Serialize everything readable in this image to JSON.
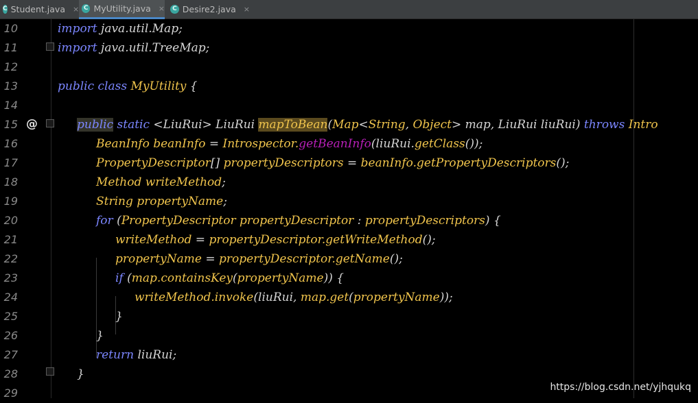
{
  "tabs": [
    {
      "icon": "C",
      "label": "Student.java",
      "active": false
    },
    {
      "icon": "C",
      "label": "MyUtility.java",
      "active": true
    },
    {
      "icon": "C",
      "label": "Desire2.java",
      "active": false
    }
  ],
  "tab_close_glyph": "×",
  "gutter": {
    "line_numbers": [
      "10",
      "11",
      "12",
      "13",
      "14",
      "15",
      "16",
      "17",
      "18",
      "19",
      "20",
      "21",
      "22",
      "23",
      "24",
      "25",
      "26",
      "27",
      "28",
      "29"
    ],
    "override_marker": "@"
  },
  "code_lines": [
    [
      [
        "kw",
        "import "
      ],
      [
        "pl",
        "java.util.Map;"
      ]
    ],
    [
      [
        "kw",
        "import "
      ],
      [
        "pl",
        "java.util.TreeMap;"
      ]
    ],
    [],
    [
      [
        "kw",
        "public class "
      ],
      [
        "fn",
        "MyUtility "
      ],
      [
        "pl",
        "{"
      ]
    ],
    [],
    [
      [
        "kw",
        "public"
      ],
      [
        "kw",
        " static "
      ],
      [
        "pl",
        "<LiuRui> LiuRui "
      ],
      [
        "fn",
        "mapToBean"
      ],
      [
        "pl",
        "("
      ],
      [
        "ty",
        "Map"
      ],
      [
        "pl",
        "<"
      ],
      [
        "ty",
        "String"
      ],
      [
        "pl",
        ", "
      ],
      [
        "ty",
        "Object"
      ],
      [
        "pl",
        "> map, LiuRui liuRui) "
      ],
      [
        "kw",
        "throws "
      ],
      [
        "ty",
        "Intro"
      ]
    ],
    [
      [
        "ty",
        "BeanInfo beanInfo "
      ],
      [
        "pl",
        "= "
      ],
      [
        "ty",
        "Introspector."
      ],
      [
        "call",
        "getBeanInfo"
      ],
      [
        "pl",
        "(liuRui."
      ],
      [
        "ty",
        "getClass"
      ],
      [
        "pl",
        "());"
      ]
    ],
    [
      [
        "ty",
        "PropertyDescriptor"
      ],
      [
        "pl",
        "[] "
      ],
      [
        "ty",
        "propertyDescriptors "
      ],
      [
        "pl",
        "= "
      ],
      [
        "ty",
        "beanInfo.getPropertyDescriptors"
      ],
      [
        "pl",
        "();"
      ]
    ],
    [
      [
        "ty",
        "Method writeMethod"
      ],
      [
        "pl",
        ";"
      ]
    ],
    [
      [
        "ty",
        "String propertyName"
      ],
      [
        "pl",
        ";"
      ]
    ],
    [
      [
        "kw",
        "for "
      ],
      [
        "pl",
        "("
      ],
      [
        "ty",
        "PropertyDescriptor propertyDescriptor "
      ],
      [
        "pl",
        ": "
      ],
      [
        "ty",
        "propertyDescriptors"
      ],
      [
        "pl",
        ") {"
      ]
    ],
    [
      [
        "ty",
        "writeMethod "
      ],
      [
        "pl",
        "= "
      ],
      [
        "ty",
        "propertyDescriptor.getWriteMethod"
      ],
      [
        "pl",
        "();"
      ]
    ],
    [
      [
        "ty",
        "propertyName "
      ],
      [
        "pl",
        "= "
      ],
      [
        "ty",
        "propertyDescriptor.getName"
      ],
      [
        "pl",
        "();"
      ]
    ],
    [
      [
        "kw",
        "if "
      ],
      [
        "pl",
        "("
      ],
      [
        "ty",
        "map.containsKey"
      ],
      [
        "pl",
        "("
      ],
      [
        "ty",
        "propertyName"
      ],
      [
        "pl",
        ")) {"
      ]
    ],
    [
      [
        "ty",
        "writeMethod.invoke"
      ],
      [
        "pl",
        "(liuRui, "
      ],
      [
        "ty",
        "map.get"
      ],
      [
        "pl",
        "("
      ],
      [
        "ty",
        "propertyName"
      ],
      [
        "pl",
        "));"
      ]
    ],
    [
      [
        "pl",
        "}"
      ]
    ],
    [
      [
        "pl",
        "}"
      ]
    ],
    [
      [
        "kw",
        "return "
      ],
      [
        "pl",
        "liuRui;"
      ]
    ],
    [
      [
        "pl",
        "}"
      ]
    ],
    []
  ],
  "watermark": "https://blog.csdn.net/yjhqukq",
  "colors": {
    "background": "#000000",
    "keyword": "#7b86ff",
    "identifier": "#f0c44c",
    "plain": "#d6d6d6",
    "method_call": "#b71fb7",
    "tab_active_underline": "#4a88c7"
  }
}
